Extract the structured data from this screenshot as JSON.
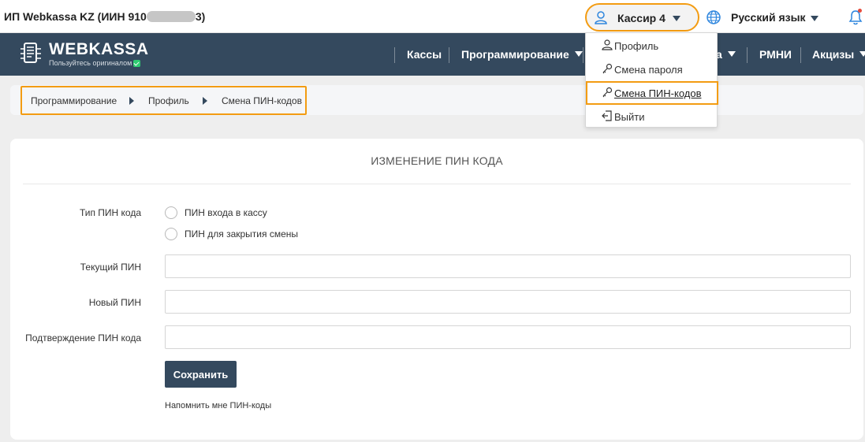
{
  "topbar": {
    "company_prefix": "ИП Webkassa KZ (ИИН 910",
    "company_suffix": "3)",
    "user_label": "Кассир 4",
    "language_label": "Русский язык"
  },
  "logo": {
    "name": "WEBKASSA",
    "tagline": "Пользуйтесь оригиналом"
  },
  "nav": {
    "items": [
      {
        "label": "Кассы",
        "has_menu": false
      },
      {
        "label": "Программирование",
        "has_menu": true
      },
      {
        "label": "а",
        "has_menu": true
      },
      {
        "label": "РМНИ",
        "has_menu": false
      },
      {
        "label": "Акцизы",
        "has_menu": true
      }
    ]
  },
  "user_menu": {
    "items": [
      {
        "label": "Профиль",
        "icon": "user-icon"
      },
      {
        "label": "Смена пароля",
        "icon": "key-icon"
      },
      {
        "label": "Смена ПИН-кодов",
        "icon": "key-icon",
        "active": true
      },
      {
        "label": "Выйти",
        "icon": "logout-icon"
      }
    ]
  },
  "breadcrumb": {
    "items": [
      "Программирование",
      "Профиль",
      "Смена ПИН-кодов"
    ]
  },
  "form": {
    "title": "ИЗМЕНЕНИЕ ПИН КОДА",
    "pin_type_label": "Тип ПИН кода",
    "pin_type_options": [
      "ПИН входа в кассу",
      "ПИН для закрытия смены"
    ],
    "current_pin_label": "Текущий ПИН",
    "current_pin_value": "",
    "new_pin_label": "Новый ПИН",
    "new_pin_value": "",
    "confirm_pin_label": "Подтверждение ПИН кода",
    "confirm_pin_value": "",
    "save_label": "Сохранить",
    "remind_label": "Напомнить мне ПИН-коды"
  },
  "colors": {
    "navbar": "#34495e",
    "highlight": "#f39c12",
    "notification": "#e74c3c"
  }
}
